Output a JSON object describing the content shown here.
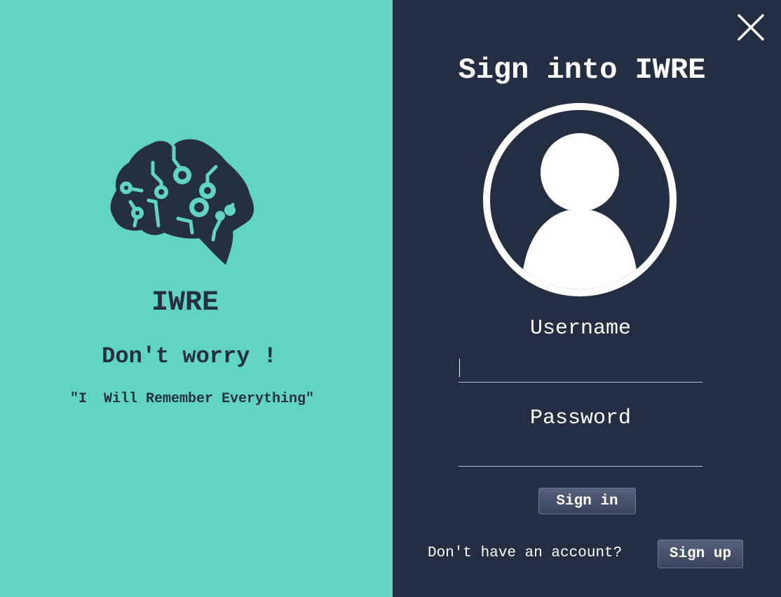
{
  "brand": {
    "name": "IWRE",
    "tagline": "Don't worry !",
    "motto": "\"I  Will Remember Everything\""
  },
  "signin": {
    "title": "Sign into IWRE",
    "username_label": "Username",
    "username_value": "",
    "password_label": "Password",
    "password_value": "",
    "signin_button": "Sign in",
    "signup_prompt": "Don't have an account?",
    "signup_button": "Sign up"
  },
  "icons": {
    "close": "close-icon",
    "logo": "brain-circuit-logo",
    "avatar": "user-avatar-icon"
  },
  "colors": {
    "left_panel": "#61d4c3",
    "right_panel": "#242e42",
    "brand_text": "#243040",
    "button": "#4a546c"
  }
}
